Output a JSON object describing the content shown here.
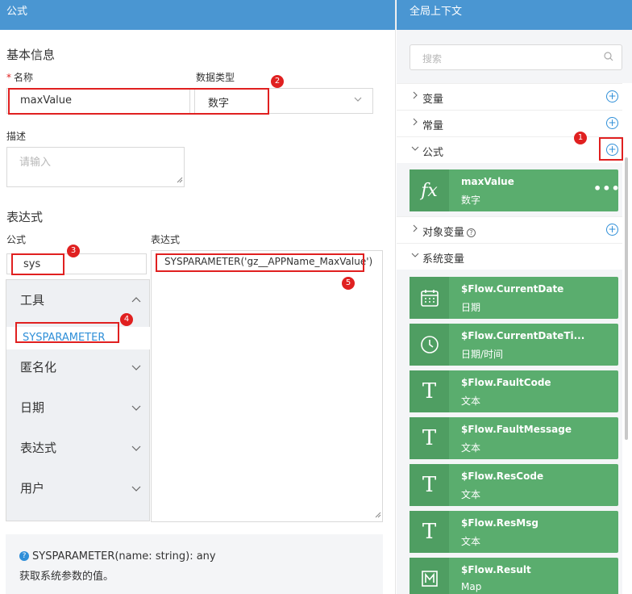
{
  "left": {
    "header_title": "公式",
    "basic_info_title": "基本信息",
    "name_label": "名称",
    "name_value": "maxValue",
    "datatype_label": "数据类型",
    "datatype_value": "数字",
    "desc_label": "描述",
    "desc_placeholder": "请输入",
    "expression_section_title": "表达式",
    "formula_col_label": "公式",
    "expression_col_label": "表达式",
    "search_value": "sys",
    "categories": [
      {
        "label": "工具",
        "expanded": true
      },
      {
        "label": "匿名化"
      },
      {
        "label": "日期"
      },
      {
        "label": "表达式"
      },
      {
        "label": "用户"
      }
    ],
    "selected_function": "SYSPARAMETER",
    "expression_text": "SYSPARAMETER('gz__APPName_MaxValue')",
    "help_signature": "SYSPARAMETER(name: string): any",
    "help_description": "获取系统参数的值。"
  },
  "right": {
    "header_title": "全局上下文",
    "search_placeholder": "搜索",
    "groups": {
      "variables": "变量",
      "constants": "常量",
      "formulas": "公式",
      "object_variables": "对象变量",
      "system_variables": "系统变量"
    },
    "formula_cards": [
      {
        "name": "maxValue",
        "type": "数字",
        "icon": "fx-icon",
        "dots": "•••"
      }
    ],
    "system_cards": [
      {
        "name": "$Flow.CurrentDate",
        "type": "日期",
        "icon": "calendar-icon"
      },
      {
        "name": "$Flow.CurrentDateTi...",
        "type": "日期/时间",
        "icon": "clock-icon"
      },
      {
        "name": "$Flow.FaultCode",
        "type": "文本",
        "icon": "text-icon"
      },
      {
        "name": "$Flow.FaultMessage",
        "type": "文本",
        "icon": "text-icon"
      },
      {
        "name": "$Flow.ResCode",
        "type": "文本",
        "icon": "text-icon"
      },
      {
        "name": "$Flow.ResMsg",
        "type": "文本",
        "icon": "text-icon"
      },
      {
        "name": "$Flow.Result",
        "type": "Map",
        "icon": "map-icon"
      }
    ]
  },
  "annotations": [
    "1",
    "2",
    "3",
    "4",
    "5"
  ],
  "colors": {
    "header": "#4a96d2",
    "card": "#5aad6e",
    "accent": "#2f8fd8",
    "highlight": "#e02020"
  }
}
